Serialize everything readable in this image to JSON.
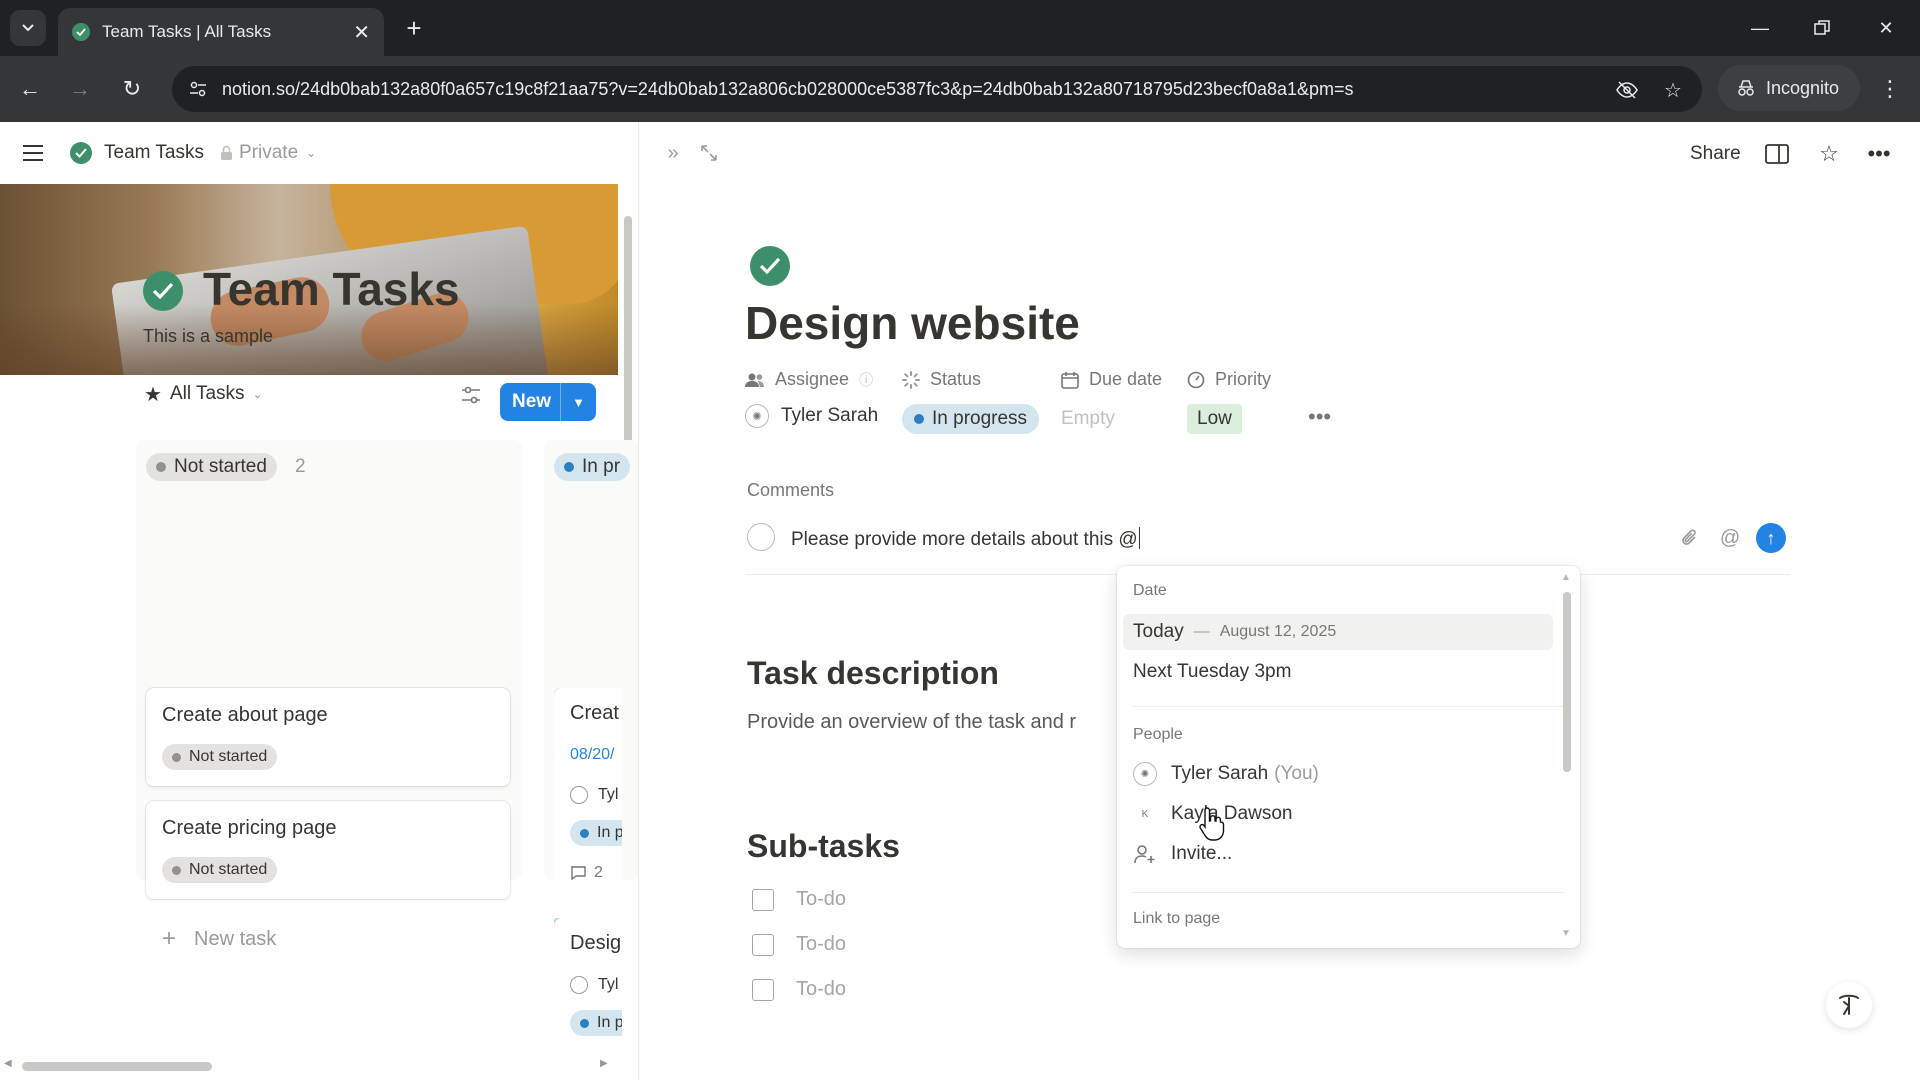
{
  "browser": {
    "tab_title": "Team Tasks | All Tasks",
    "url": "notion.so/24db0bab132a80f0a657c19c8f21aa75?v=24db0bab132a806cb028000ce5387fc3&p=24db0bab132a80718795d23becf0a8a1&pm=s",
    "incognito_label": "Incognito"
  },
  "topbar": {
    "breadcrumb_title": "Team Tasks",
    "privacy": "Private",
    "share_label": "Share"
  },
  "database": {
    "title": "Team Tasks",
    "description": "This is a sample",
    "view_name": "All Tasks",
    "new_button": "New",
    "columns": [
      {
        "status": "Not started",
        "count": "2",
        "cards": [
          {
            "title": "Create about page",
            "status": "Not started"
          },
          {
            "title": "Create pricing page",
            "status": "Not started"
          }
        ],
        "new_task_label": "New task"
      },
      {
        "status": "In pr",
        "cards": [
          {
            "title": "Creat",
            "date": "08/20/",
            "assignee": "Tyl",
            "status": "In p",
            "comments": "2"
          },
          {
            "title": "Desig",
            "assignee": "Tyl",
            "status": "In p"
          }
        ]
      }
    ]
  },
  "page": {
    "title": "Design website",
    "properties": {
      "assignee_label": "Assignee",
      "status_label": "Status",
      "due_label": "Due date",
      "priority_label": "Priority",
      "assignee_value": "Tyler Sarah",
      "status_value": "In progress",
      "due_value": "Empty",
      "priority_value": "Low"
    },
    "comments_label": "Comments",
    "comment_draft": "Please provide more details about this @",
    "task_description_heading": "Task description",
    "task_description_text": "Provide an overview of the task and r",
    "subtasks_heading": "Sub-tasks",
    "todos": [
      "To-do",
      "To-do",
      "To-do"
    ]
  },
  "mention_menu": {
    "date_group": "Date",
    "today_label": "Today",
    "today_date": "August 12, 2025",
    "next_label": "Next Tuesday 3pm",
    "people_group": "People",
    "person1_name": "Tyler Sarah",
    "person1_suffix": "(You)",
    "person2_initial": "K",
    "person2_name": "Kayla Dawson",
    "invite_label": "Invite...",
    "link_group": "Link to page"
  },
  "colors": {
    "accent_blue": "#2383e2",
    "brand_green": "#3d8f6b",
    "status_blue_bg": "#d3e5ef",
    "status_grey_bg": "#e3e2e0",
    "priority_low_bg": "#dbeddb"
  }
}
